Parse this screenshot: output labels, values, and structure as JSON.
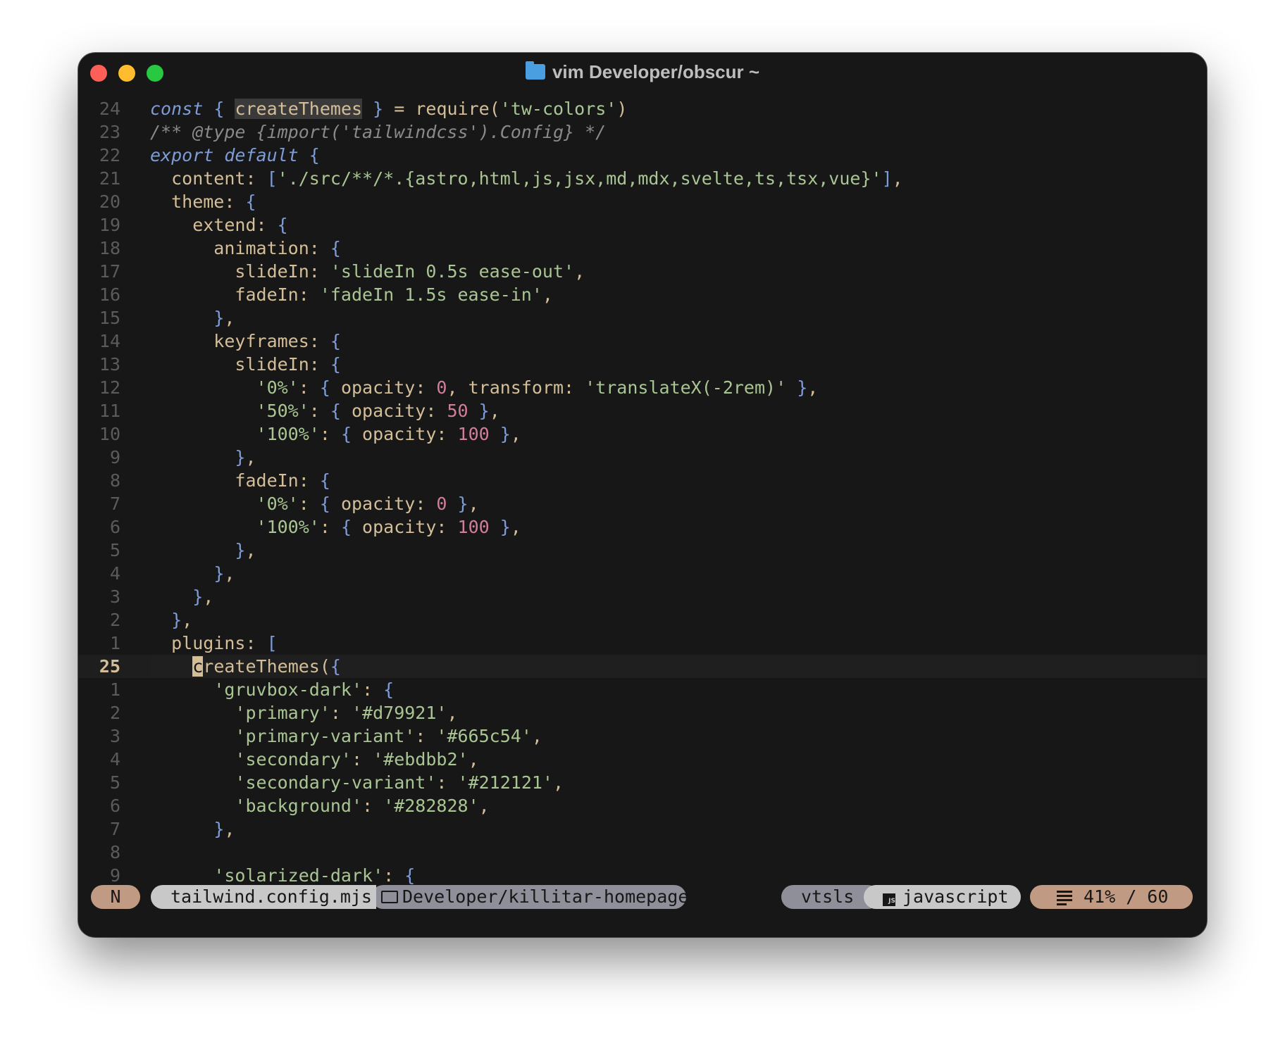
{
  "window": {
    "title": "vim Developer/obscur ~"
  },
  "editor": {
    "cursor_line_number": "25",
    "lines": [
      {
        "ln": "24",
        "tokens": [
          [
            "kw",
            "const"
          ],
          [
            "pl",
            " "
          ],
          [
            "br",
            "{"
          ],
          [
            "pl",
            " "
          ],
          [
            "hl",
            "createThemes"
          ],
          [
            "pl",
            " "
          ],
          [
            "br",
            "}"
          ],
          [
            "pl",
            " = require("
          ],
          [
            "st",
            "'tw-colors'"
          ],
          [
            "pl",
            ")"
          ]
        ]
      },
      {
        "ln": "23",
        "tokens": [
          [
            "cm",
            "/** @type {import('tailwindcss').Config} */"
          ]
        ]
      },
      {
        "ln": "22",
        "tokens": [
          [
            "kw",
            "export"
          ],
          [
            "pl",
            " "
          ],
          [
            "kw2",
            "default"
          ],
          [
            "pl",
            " "
          ],
          [
            "br",
            "{"
          ]
        ]
      },
      {
        "ln": "21",
        "tokens": [
          [
            "pl",
            "  content: "
          ],
          [
            "br",
            "["
          ],
          [
            "st",
            "'./src/**/*.{astro,html,js,jsx,md,mdx,svelte,ts,tsx,vue}'"
          ],
          [
            "br",
            "]"
          ],
          [
            "pl",
            ","
          ]
        ]
      },
      {
        "ln": "20",
        "tokens": [
          [
            "pl",
            "  theme: "
          ],
          [
            "br",
            "{"
          ]
        ]
      },
      {
        "ln": "19",
        "tokens": [
          [
            "pl",
            "    extend: "
          ],
          [
            "br",
            "{"
          ]
        ]
      },
      {
        "ln": "18",
        "tokens": [
          [
            "pl",
            "      animation: "
          ],
          [
            "br",
            "{"
          ]
        ]
      },
      {
        "ln": "17",
        "tokens": [
          [
            "pl",
            "        slideIn: "
          ],
          [
            "st",
            "'slideIn 0.5s ease-out'"
          ],
          [
            "pl",
            ","
          ]
        ]
      },
      {
        "ln": "16",
        "tokens": [
          [
            "pl",
            "        fadeIn: "
          ],
          [
            "st",
            "'fadeIn 1.5s ease-in'"
          ],
          [
            "pl",
            ","
          ]
        ]
      },
      {
        "ln": "15",
        "tokens": [
          [
            "pl",
            "      "
          ],
          [
            "br",
            "}"
          ],
          [
            "pl",
            ","
          ]
        ]
      },
      {
        "ln": "14",
        "tokens": [
          [
            "pl",
            "      keyframes: "
          ],
          [
            "br",
            "{"
          ]
        ]
      },
      {
        "ln": "13",
        "tokens": [
          [
            "pl",
            "        slideIn: "
          ],
          [
            "br",
            "{"
          ]
        ]
      },
      {
        "ln": "12",
        "tokens": [
          [
            "pl",
            "          "
          ],
          [
            "st",
            "'0%'"
          ],
          [
            "pl",
            ": "
          ],
          [
            "br",
            "{"
          ],
          [
            "pl",
            " opacity: "
          ],
          [
            "nu",
            "0"
          ],
          [
            "pl",
            ", transform: "
          ],
          [
            "st",
            "'translateX(-2rem)'"
          ],
          [
            "pl",
            " "
          ],
          [
            "br",
            "}"
          ],
          [
            "pl",
            ","
          ]
        ]
      },
      {
        "ln": "11",
        "tokens": [
          [
            "pl",
            "          "
          ],
          [
            "st",
            "'50%'"
          ],
          [
            "pl",
            ": "
          ],
          [
            "br",
            "{"
          ],
          [
            "pl",
            " opacity: "
          ],
          [
            "nu",
            "50"
          ],
          [
            "pl",
            " "
          ],
          [
            "br",
            "}"
          ],
          [
            "pl",
            ","
          ]
        ]
      },
      {
        "ln": "10",
        "tokens": [
          [
            "pl",
            "          "
          ],
          [
            "st",
            "'100%'"
          ],
          [
            "pl",
            ": "
          ],
          [
            "br",
            "{"
          ],
          [
            "pl",
            " opacity: "
          ],
          [
            "nu",
            "100"
          ],
          [
            "pl",
            " "
          ],
          [
            "br",
            "}"
          ],
          [
            "pl",
            ","
          ]
        ]
      },
      {
        "ln": "9",
        "tokens": [
          [
            "pl",
            "        "
          ],
          [
            "br",
            "}"
          ],
          [
            "pl",
            ","
          ]
        ]
      },
      {
        "ln": "8",
        "tokens": [
          [
            "pl",
            "        fadeIn: "
          ],
          [
            "br",
            "{"
          ]
        ]
      },
      {
        "ln": "7",
        "tokens": [
          [
            "pl",
            "          "
          ],
          [
            "st",
            "'0%'"
          ],
          [
            "pl",
            ": "
          ],
          [
            "br",
            "{"
          ],
          [
            "pl",
            " opacity: "
          ],
          [
            "nu",
            "0"
          ],
          [
            "pl",
            " "
          ],
          [
            "br",
            "}"
          ],
          [
            "pl",
            ","
          ]
        ]
      },
      {
        "ln": "6",
        "tokens": [
          [
            "pl",
            "          "
          ],
          [
            "st",
            "'100%'"
          ],
          [
            "pl",
            ": "
          ],
          [
            "br",
            "{"
          ],
          [
            "pl",
            " opacity: "
          ],
          [
            "nu",
            "100"
          ],
          [
            "pl",
            " "
          ],
          [
            "br",
            "}"
          ],
          [
            "pl",
            ","
          ]
        ]
      },
      {
        "ln": "5",
        "tokens": [
          [
            "pl",
            "        "
          ],
          [
            "br",
            "}"
          ],
          [
            "pl",
            ","
          ]
        ]
      },
      {
        "ln": "4",
        "tokens": [
          [
            "pl",
            "      "
          ],
          [
            "br",
            "}"
          ],
          [
            "pl",
            ","
          ]
        ]
      },
      {
        "ln": "3",
        "tokens": [
          [
            "pl",
            "    "
          ],
          [
            "br",
            "}"
          ],
          [
            "pl",
            ","
          ]
        ]
      },
      {
        "ln": "2",
        "tokens": [
          [
            "pl",
            "  "
          ],
          [
            "br",
            "}"
          ],
          [
            "pl",
            ","
          ]
        ]
      },
      {
        "ln": "1",
        "tokens": [
          [
            "pl",
            "  plugins: "
          ],
          [
            "br",
            "["
          ]
        ]
      },
      {
        "ln": "25",
        "current": true,
        "tokens": [
          [
            "pl",
            "    "
          ],
          [
            "cur",
            "c"
          ],
          [
            "pl",
            "reateThemes("
          ],
          [
            "br",
            "{"
          ]
        ]
      },
      {
        "ln": "1",
        "tokens": [
          [
            "pl",
            "      "
          ],
          [
            "st",
            "'gruvbox-dark'"
          ],
          [
            "pl",
            ": "
          ],
          [
            "br",
            "{"
          ]
        ]
      },
      {
        "ln": "2",
        "tokens": [
          [
            "pl",
            "        "
          ],
          [
            "st",
            "'primary'"
          ],
          [
            "pl",
            ": "
          ],
          [
            "st",
            "'#d79921'"
          ],
          [
            "pl",
            ","
          ]
        ]
      },
      {
        "ln": "3",
        "tokens": [
          [
            "pl",
            "        "
          ],
          [
            "st",
            "'primary-variant'"
          ],
          [
            "pl",
            ": "
          ],
          [
            "st",
            "'#665c54'"
          ],
          [
            "pl",
            ","
          ]
        ]
      },
      {
        "ln": "4",
        "tokens": [
          [
            "pl",
            "        "
          ],
          [
            "st",
            "'secondary'"
          ],
          [
            "pl",
            ": "
          ],
          [
            "st",
            "'#ebdbb2'"
          ],
          [
            "pl",
            ","
          ]
        ]
      },
      {
        "ln": "5",
        "tokens": [
          [
            "pl",
            "        "
          ],
          [
            "st",
            "'secondary-variant'"
          ],
          [
            "pl",
            ": "
          ],
          [
            "st",
            "'#212121'"
          ],
          [
            "pl",
            ","
          ]
        ]
      },
      {
        "ln": "6",
        "tokens": [
          [
            "pl",
            "        "
          ],
          [
            "st",
            "'background'"
          ],
          [
            "pl",
            ": "
          ],
          [
            "st",
            "'#282828'"
          ],
          [
            "pl",
            ","
          ]
        ]
      },
      {
        "ln": "7",
        "tokens": [
          [
            "pl",
            "      "
          ],
          [
            "br",
            "}"
          ],
          [
            "pl",
            ","
          ]
        ]
      },
      {
        "ln": "8",
        "tokens": []
      },
      {
        "ln": "9",
        "tokens": [
          [
            "pl",
            "      "
          ],
          [
            "st",
            "'solarized-dark'"
          ],
          [
            "pl",
            ": "
          ],
          [
            "br",
            "{"
          ]
        ]
      }
    ]
  },
  "statusline": {
    "mode": "N",
    "filename": "tailwind.config.mjs",
    "directory": "Developer/killitar-homepage",
    "lsp": "vtsls",
    "filetype": "javascript",
    "position": "41% / 60"
  },
  "colors": {
    "keyword": "#7e9cd8",
    "string": "#a9c593",
    "number": "#d27e99",
    "text": "#d4be98",
    "comment": "#8a8a8a"
  },
  "icons": {
    "title": "folder-icon",
    "directory": "folder-outline-icon",
    "filetype": "javascript-icon",
    "position": "lines-icon"
  }
}
